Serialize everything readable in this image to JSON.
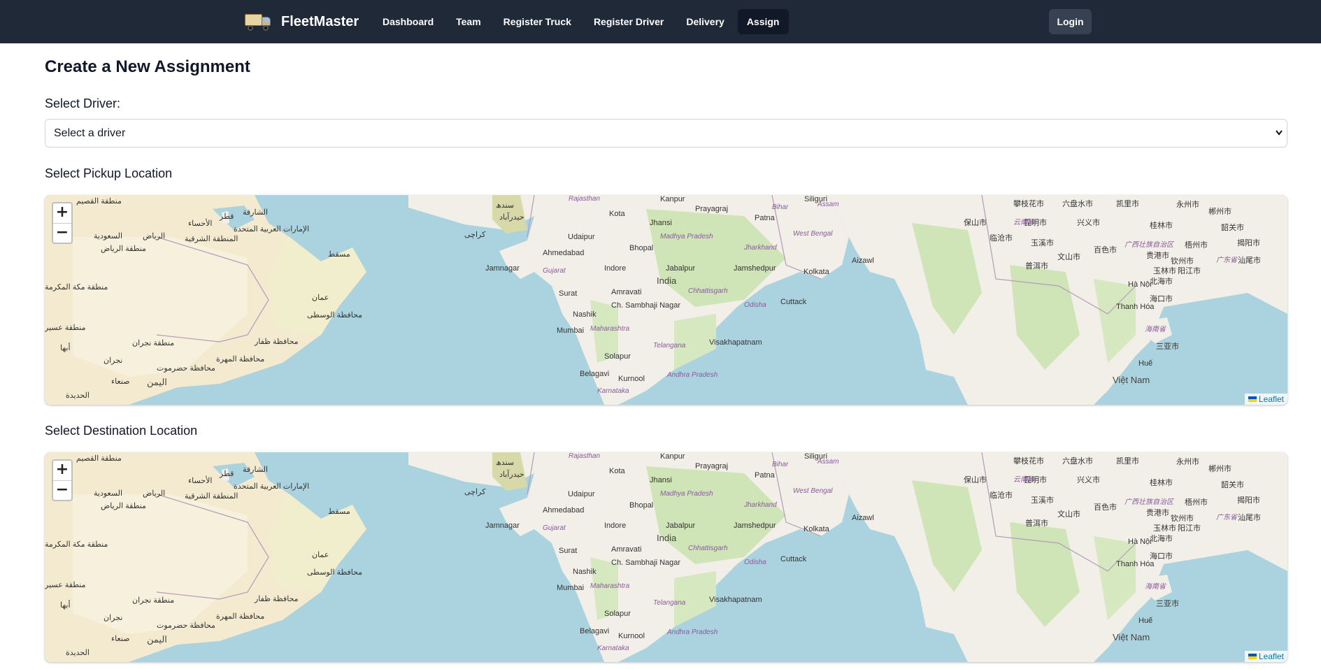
{
  "nav": {
    "brand": "FleetMaster",
    "links": [
      "Dashboard",
      "Team",
      "Register Truck",
      "Register Driver",
      "Delivery",
      "Assign"
    ],
    "active_index": 5,
    "login": "Login"
  },
  "page": {
    "title": "Create a New Assignment",
    "driver_label": "Select Driver:",
    "driver_select": "Select a driver",
    "pickup_label": "Select Pickup Location",
    "destination_label": "Select Destination Location"
  },
  "map": {
    "zoom_in": "+",
    "zoom_out": "−",
    "attribution": "Leaflet",
    "labels": [
      "Kanpur",
      "Prayagraj",
      "Siliguri",
      "Kota",
      "Jhansi",
      "Patna",
      "Assam",
      "Udaipur",
      "Bhopal",
      "Madhya Pradesh",
      "Jharkhand",
      "Ahmedabad",
      "Indore",
      "Jabalpur",
      "Jamshedpur",
      "Kolkata",
      "Aizawl",
      "West Bengal",
      "Bihar",
      "Jamnagar",
      "Gujarat",
      "India",
      "Chhattisgarh",
      "Surat",
      "Amravati",
      "Odisha",
      "Cuttack",
      "Nashik",
      "Ch. Sambhaji Nagar",
      "Mumbai",
      "Maharashtra",
      "Visakhapatnam",
      "Telangana",
      "Solapur",
      "Belagavi",
      "Kurnool",
      "Andhra Pradesh",
      "Karnataka",
      "Hà Nội",
      "Thanh Hóa",
      "Huế",
      "Việt Nam",
      "攀枝花市",
      "六盘水市",
      "凯里市",
      "永州市",
      "郴州市",
      "保山市",
      "昆明市",
      "兴义市",
      "桂林市",
      "韶关市",
      "临沧市",
      "玉溪市",
      "百色市",
      "梧州市",
      "揭阳市",
      "文山市",
      "贵港市",
      "汕尾市",
      "普洱市",
      "玉林市",
      "阳江市",
      "钦州市",
      "北海市",
      "海口市",
      "三亚市",
      "云南省",
      "广西壮族自治区",
      "广东省",
      "海南省",
      "السعودية",
      "الرياض",
      "منطقة الرياض",
      "الأحساء",
      "قطر",
      "الشارقة",
      "الإمارات العربية المتحدة",
      "المنطقة الشرقية",
      "مسقط",
      "عمان",
      "محافظة الوسطى",
      "منطقة مكة المكرمة",
      "منطقة نجران",
      "نجران",
      "منطقة عسير",
      "أبها",
      "محافظة ظفار",
      "محافظة المهرة",
      "محافظة حضرموت",
      "صنعاء",
      "اليمن",
      "الحديدة",
      "منطقة القصيم",
      "كراچی",
      "سندھ",
      "حیدرآباد",
      "Rajasthan"
    ]
  }
}
